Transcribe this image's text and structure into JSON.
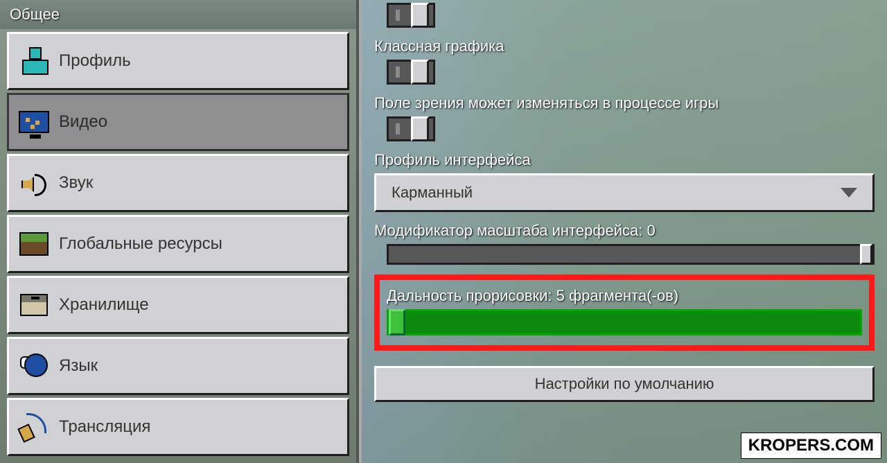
{
  "sidebar": {
    "header": "Общее",
    "items": [
      {
        "label": "Профиль"
      },
      {
        "label": "Видео"
      },
      {
        "label": "Звук"
      },
      {
        "label": "Глобальные ресурсы"
      },
      {
        "label": "Хранилище"
      },
      {
        "label": "Язык"
      },
      {
        "label": "Трансляция"
      }
    ]
  },
  "options": {
    "fancy_graphics_label": "Классная графика",
    "fov_toggle_label": "Поле зрения может изменяться в процессе игры",
    "ui_profile_label": "Профиль интерфейса",
    "ui_profile_value": "Карманный",
    "gui_scale_label": "Модификатор масштаба интерфейса: 0",
    "render_distance_label": "Дальность прорисовки: 5 фрагмента(-ов)",
    "defaults_button": "Настройки по умолчанию"
  },
  "watermark": "KROPERS.COM"
}
